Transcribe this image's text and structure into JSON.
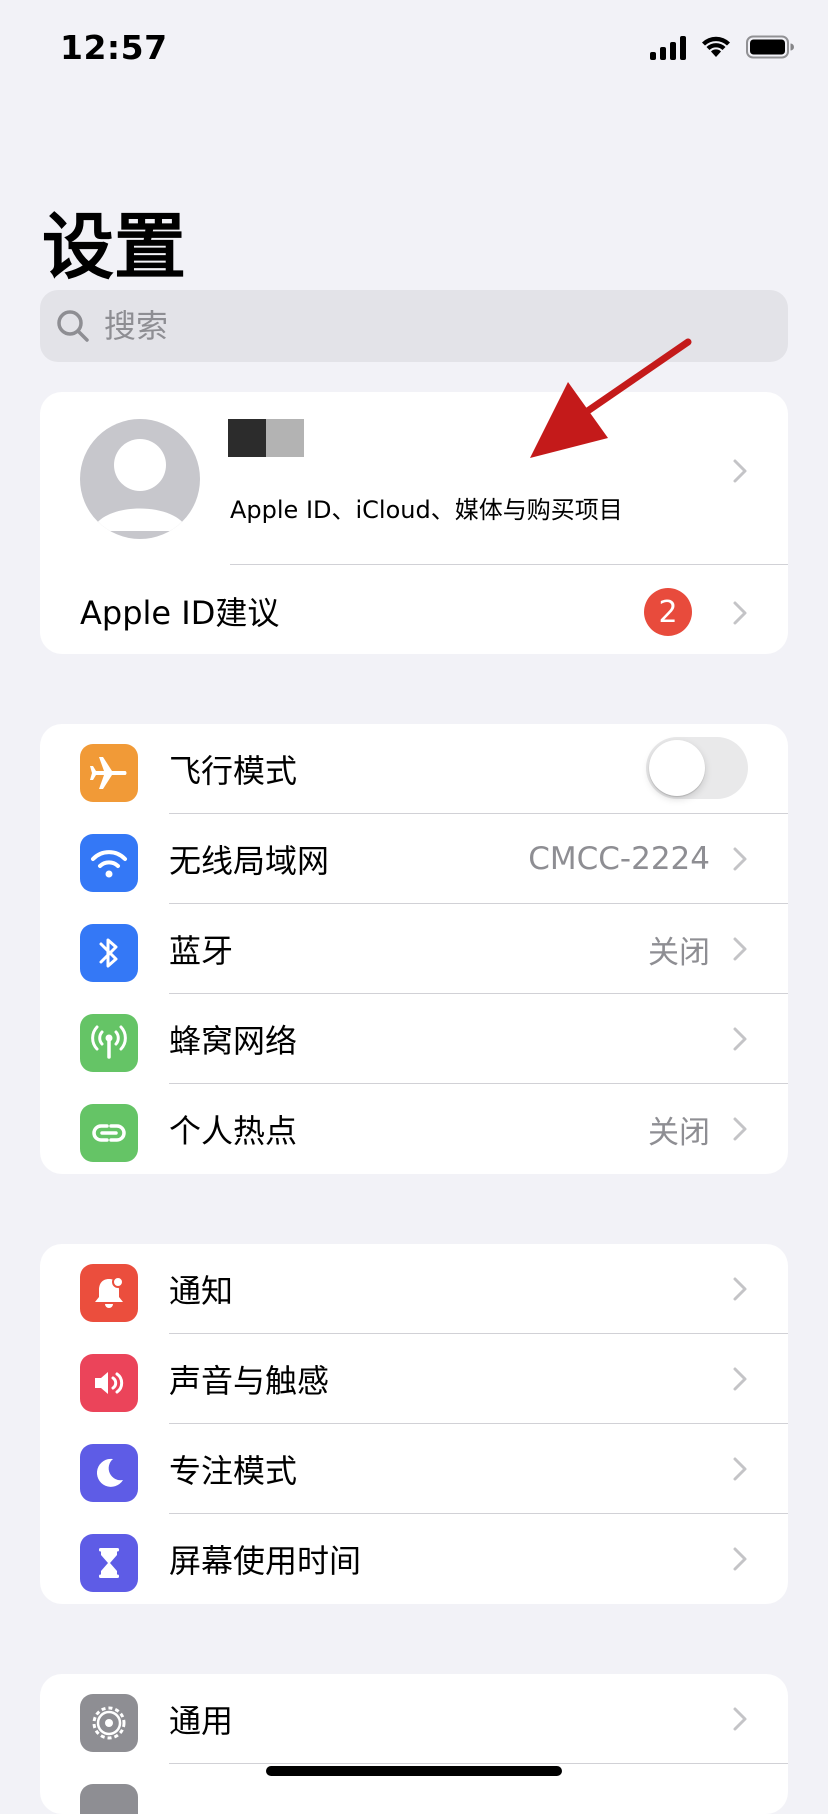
{
  "status_bar": {
    "time": "12:57"
  },
  "page": {
    "title": "设置"
  },
  "search": {
    "placeholder": "搜索"
  },
  "profile": {
    "subtitle": "Apple ID、iCloud、媒体与购买项目",
    "suggestion_label": "Apple ID建议",
    "badge_count": "2"
  },
  "connectivity": [
    {
      "label": "飞行模式",
      "icon": "airplane-icon",
      "color": "#f19a37",
      "toggle": false
    },
    {
      "label": "无线局域网",
      "icon": "wifi-icon",
      "color": "#3478f6",
      "value": "CMCC-2224"
    },
    {
      "label": "蓝牙",
      "icon": "bluetooth-icon",
      "color": "#3478f6",
      "value": "关闭"
    },
    {
      "label": "蜂窝网络",
      "icon": "antenna-icon",
      "color": "#65c466"
    },
    {
      "label": "个人热点",
      "icon": "hotspot-icon",
      "color": "#65c466",
      "value": "关闭"
    }
  ],
  "notifications": [
    {
      "label": "通知",
      "icon": "bell-icon",
      "color": "#eb4e3d"
    },
    {
      "label": "声音与触感",
      "icon": "speaker-icon",
      "color": "#eb445a"
    },
    {
      "label": "专注模式",
      "icon": "moon-icon",
      "color": "#5e5ce6"
    },
    {
      "label": "屏幕使用时间",
      "icon": "hourglass-icon",
      "color": "#5e5ce6"
    }
  ],
  "general": [
    {
      "label": "通用",
      "icon": "gear-icon",
      "color": "#8e8e93"
    }
  ]
}
